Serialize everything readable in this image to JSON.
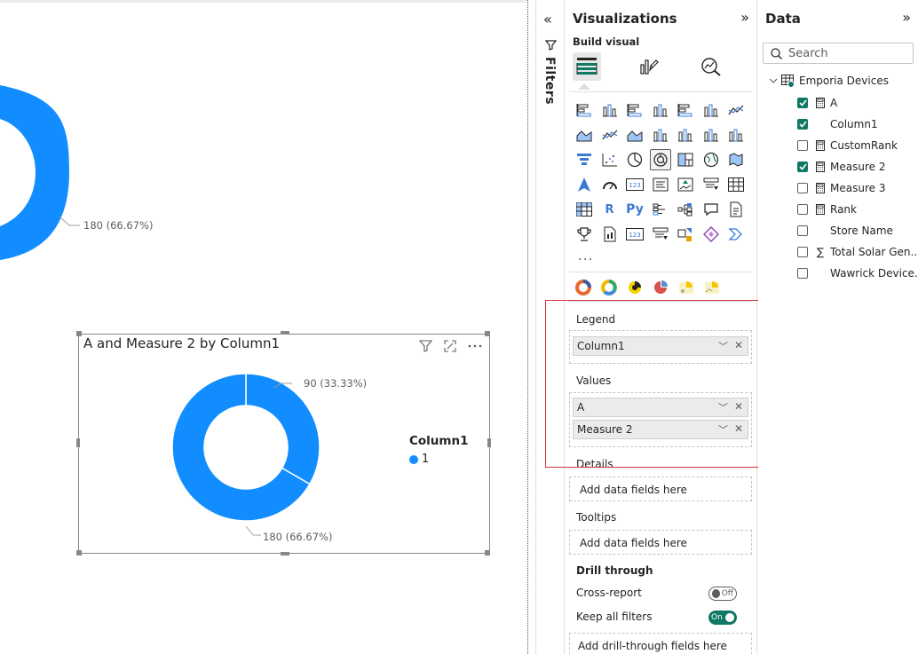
{
  "canvas": {
    "top_donut_label": "180 (66.67%)",
    "visual": {
      "title": "A and Measure 2 by Column1",
      "label_small": "90 (33.33%)",
      "label_large": "180 (66.67%)",
      "legend_title": "Column1",
      "legend_item": "1",
      "slice_color": "#118dff"
    }
  },
  "filters": {
    "label": "Filters"
  },
  "visualizations": {
    "title": "Visualizations",
    "build_visual_label": "Build visual",
    "more_label": "...",
    "wells": {
      "legend": {
        "label": "Legend",
        "chips": [
          "Column1"
        ]
      },
      "values": {
        "label": "Values",
        "chips": [
          "A",
          "Measure 2"
        ]
      },
      "details": {
        "label": "Details",
        "placeholder": "Add data fields here"
      },
      "tooltips": {
        "label": "Tooltips",
        "placeholder": "Add data fields here"
      }
    },
    "drill_through": {
      "label": "Drill through",
      "cross_report": {
        "label": "Cross-report",
        "state": "Off"
      },
      "keep_all_filters": {
        "label": "Keep all filters",
        "state": "On"
      },
      "placeholder": "Add drill-through fields here"
    },
    "gallery_text": {
      "r": "R",
      "py": "Py",
      "num": "123"
    }
  },
  "data_pane": {
    "title": "Data",
    "search_placeholder": "Search",
    "table_name": "Emporia Devices",
    "fields": [
      {
        "name": "A",
        "checked": true,
        "type": "calculator-icon"
      },
      {
        "name": "Column1",
        "checked": true,
        "type": ""
      },
      {
        "name": "CustomRank",
        "checked": false,
        "type": "calculator-icon"
      },
      {
        "name": "Measure 2",
        "checked": true,
        "type": "calculator-icon"
      },
      {
        "name": "Measure 3",
        "checked": false,
        "type": "calculator-icon"
      },
      {
        "name": "Rank",
        "checked": false,
        "type": "calculator-icon"
      },
      {
        "name": "Store Name",
        "checked": false,
        "type": ""
      },
      {
        "name": "Total Solar Gen...",
        "checked": false,
        "type": "sigma-icon"
      },
      {
        "name": "Wawrick Device...",
        "checked": false,
        "type": ""
      }
    ]
  },
  "colors": {
    "accent": "#117865",
    "chart_blue": "#118dff",
    "highlight_border": "#d13438"
  }
}
